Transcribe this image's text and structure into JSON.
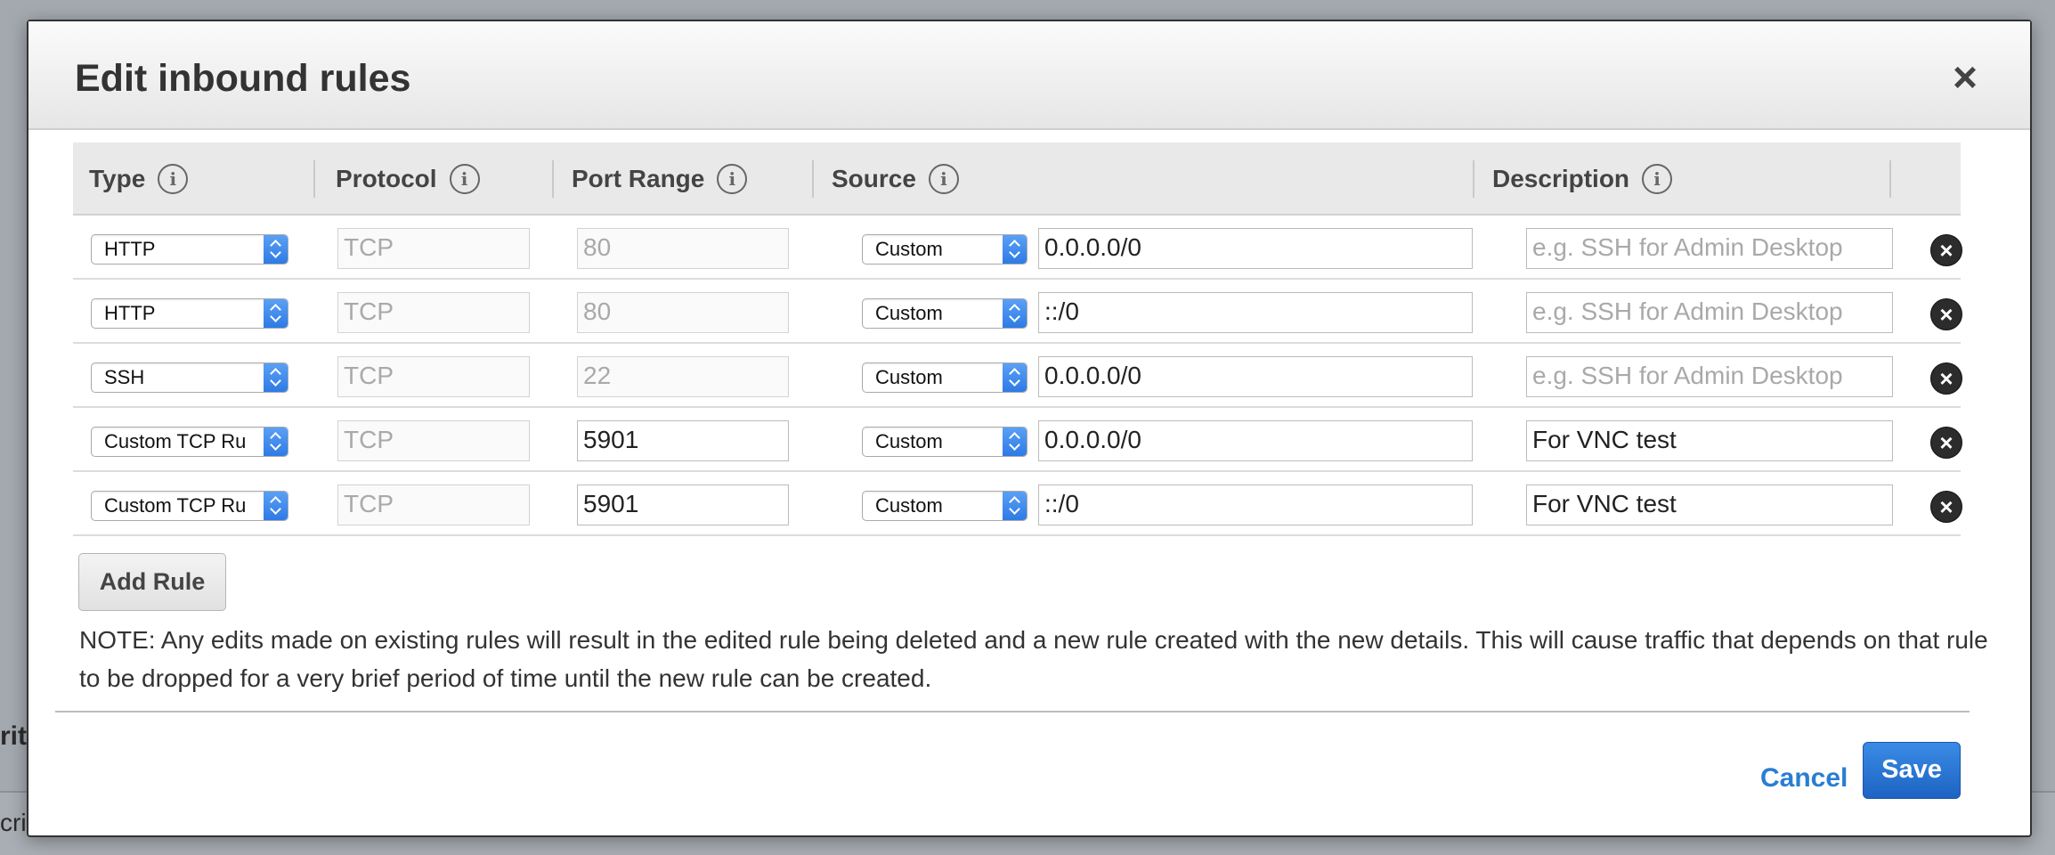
{
  "modal": {
    "title": "Edit inbound rules",
    "close_label": "×"
  },
  "background": {
    "fragment_1": "rity",
    "fragment_2": "cri"
  },
  "columns": {
    "type": "Type",
    "protocol": "Protocol",
    "port_range": "Port Range",
    "source": "Source",
    "description": "Description",
    "info_glyph": "i"
  },
  "rules": [
    {
      "type": "HTTP",
      "protocol": "TCP",
      "port": "80",
      "source_type": "Custom",
      "source": "0.0.0.0/0",
      "description": "",
      "description_placeholder": "e.g. SSH for Admin Desktop",
      "port_editable": false
    },
    {
      "type": "HTTP",
      "protocol": "TCP",
      "port": "80",
      "source_type": "Custom",
      "source": "::/0",
      "description": "",
      "description_placeholder": "e.g. SSH for Admin Desktop",
      "port_editable": false
    },
    {
      "type": "SSH",
      "protocol": "TCP",
      "port": "22",
      "source_type": "Custom",
      "source": "0.0.0.0/0",
      "description": "",
      "description_placeholder": "e.g. SSH for Admin Desktop",
      "port_editable": false
    },
    {
      "type": "Custom TCP Ru",
      "protocol": "TCP",
      "port": "5901",
      "source_type": "Custom",
      "source": "0.0.0.0/0",
      "description": "For VNC test",
      "description_placeholder": "e.g. SSH for Admin Desktop",
      "port_editable": true
    },
    {
      "type": "Custom TCP Ru",
      "protocol": "TCP",
      "port": "5901",
      "source_type": "Custom",
      "source": "::/0",
      "description": "For VNC test",
      "description_placeholder": "e.g. SSH for Admin Desktop",
      "port_editable": true
    }
  ],
  "delete_glyph": "×",
  "add_rule_label": "Add Rule",
  "note": "NOTE: Any edits made on existing rules will result in the edited rule being deleted and a new rule created with the new details. This will cause traffic that depends on that rule to be dropped for a very brief period of time until the new rule can be created.",
  "footer": {
    "cancel_label": "Cancel",
    "save_label": "Save"
  },
  "colors": {
    "primary": "#1d63c3",
    "link": "#2a7dd3",
    "overlay": "#a4a9b0"
  }
}
